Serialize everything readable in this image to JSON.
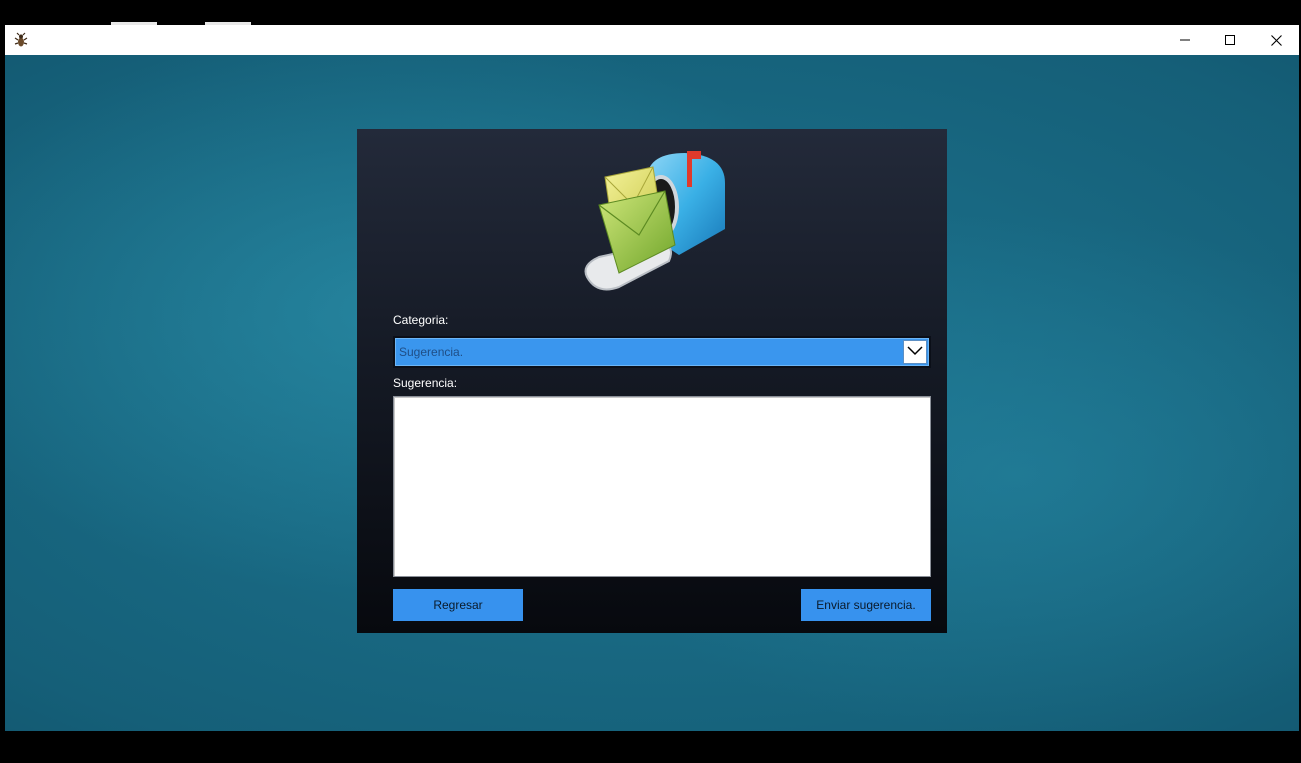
{
  "window": {
    "icon": "app-bug-icon",
    "controls": {
      "minimize": "minimize-icon",
      "maximize": "maximize-icon",
      "close": "close-icon"
    }
  },
  "form": {
    "image": "mailbox-icon",
    "category_label": "Categoria:",
    "category_selected": "Sugerencia.",
    "suggestion_label": "Sugerencia:",
    "suggestion_value": "",
    "back_button": "Regresar",
    "send_button": "Enviar sugerencia."
  },
  "colors": {
    "accent": "#3792ee",
    "panel_top": "#232a3a",
    "panel_bottom": "#07090e",
    "desktop": "#155f78"
  }
}
